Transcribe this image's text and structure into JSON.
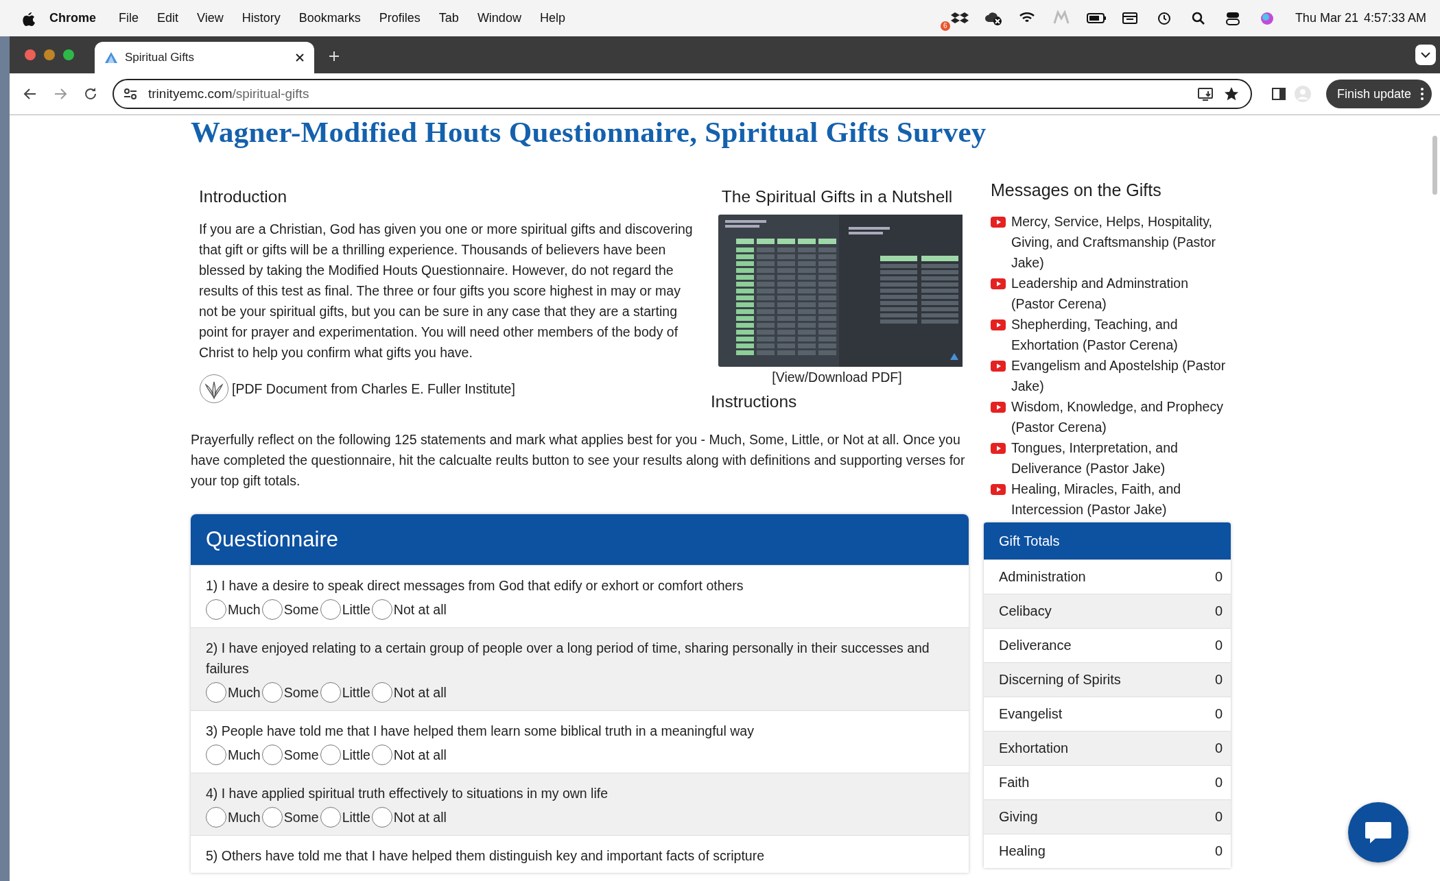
{
  "menu_bar": {
    "app": "Chrome",
    "items": [
      "File",
      "Edit",
      "View",
      "History",
      "Bookmarks",
      "Profiles",
      "Tab",
      "Window",
      "Help"
    ],
    "badge": "6",
    "date": "Thu Mar 21",
    "time": "4:57:33 AM"
  },
  "browser": {
    "tab_title": "Spiritual Gifts",
    "url_domain": "trinityemc.com",
    "url_path": "/spiritual-gifts",
    "update_button": "Finish update"
  },
  "page": {
    "title": "Wagner-Modified Houts Questionnaire, Spiritual Gifts Survey",
    "introduction": {
      "heading": "Introduction",
      "text": "If you are a Christian, God has given you one or more spiritual gifts and discovering that gift or gifts will be a thrilling experience. Thousands of believers have been blessed by taking the Modified Houts Questionnaire. However, do not regard the results of this test as final. The three or four gifts you score highest in may or may not be your spiritual gifts, but you can be sure in any case that they are a starting point for prayer and experimentation. You will need other members of the body of Christ to help you confirm what gifts you have.",
      "pdf_link": "[PDF Document from Charles E. Fuller Institute]"
    },
    "nutshell": {
      "heading": "The Spiritual Gifts in a Nutshell",
      "link": "[View/Download PDF]"
    },
    "instructions": {
      "heading": "Instructions",
      "text": "Prayerfully reflect on the following 125 statements and mark what applies best for you - Much, Some, Little, or Not at all. Once you have completed the questionnaire, hit the calcualte reults button to see your results along with definitions and supporting verses for your top gift totals."
    },
    "messages": {
      "heading": "Messages on the Gifts",
      "items": [
        "Mercy, Service, Helps, Hospitality, Giving, and Craftsmanship (Pastor Jake)",
        "Leadership and Adminstration (Pastor Cerena)",
        "Shepherding, Teaching, and Exhortation (Pastor Cerena)",
        "Evangelism and Apostelship (Pastor Jake)",
        "Wisdom, Knowledge, and Prophecy (Pastor Cerena)",
        "Tongues, Interpretation, and Deliverance (Pastor Jake)",
        "Healing, Miracles, Faith, and Intercession (Pastor Jake)"
      ]
    },
    "questionnaire": {
      "title": "Questionnaire",
      "questions": [
        {
          "text": "1) I have a desire to speak direct messages from God that edify or exhort or comfort others",
          "options": [
            {
              "label": "Much",
              "selected": false
            },
            {
              "label": "Some",
              "selected": false
            },
            {
              "label": "Little",
              "selected": false
            },
            {
              "label": "Not at all",
              "selected": false
            }
          ]
        },
        {
          "text": "2) I have enjoyed relating to a certain group of people over a long period of time, sharing personally in their successes and failures",
          "options": [
            {
              "label": "Much",
              "selected": false
            },
            {
              "label": "Some",
              "selected": false
            },
            {
              "label": "Little",
              "selected": false
            },
            {
              "label": "Not at all",
              "selected": false
            }
          ]
        },
        {
          "text": "3) People have told me that I have helped them learn some biblical truth in a meaningful way",
          "options": [
            {
              "label": "Much",
              "selected": false
            },
            {
              "label": "Some",
              "selected": false
            },
            {
              "label": "Little",
              "selected": false
            },
            {
              "label": "Not at all",
              "selected": false
            }
          ]
        },
        {
          "text": "4) I have applied spiritual truth effectively to situations in my own life",
          "options": [
            {
              "label": "Much",
              "selected": false
            },
            {
              "label": "Some",
              "selected": false
            },
            {
              "label": "Little",
              "selected": false
            },
            {
              "label": "Not at all",
              "selected": false
            }
          ]
        },
        {
          "text": "5) Others have told me that I have helped them distinguish key and important facts of scripture"
        }
      ]
    },
    "gift_totals": {
      "title": "Gift Totals",
      "rows": [
        {
          "gift": "Administration",
          "total": "0"
        },
        {
          "gift": "Celibacy",
          "total": "0"
        },
        {
          "gift": "Deliverance",
          "total": "0"
        },
        {
          "gift": "Discerning of Spirits",
          "total": "0"
        },
        {
          "gift": "Evangelist",
          "total": "0"
        },
        {
          "gift": "Exhortation",
          "total": "0"
        },
        {
          "gift": "Faith",
          "total": "0"
        },
        {
          "gift": "Giving",
          "total": "0"
        },
        {
          "gift": "Healing",
          "total": "0"
        }
      ]
    }
  }
}
